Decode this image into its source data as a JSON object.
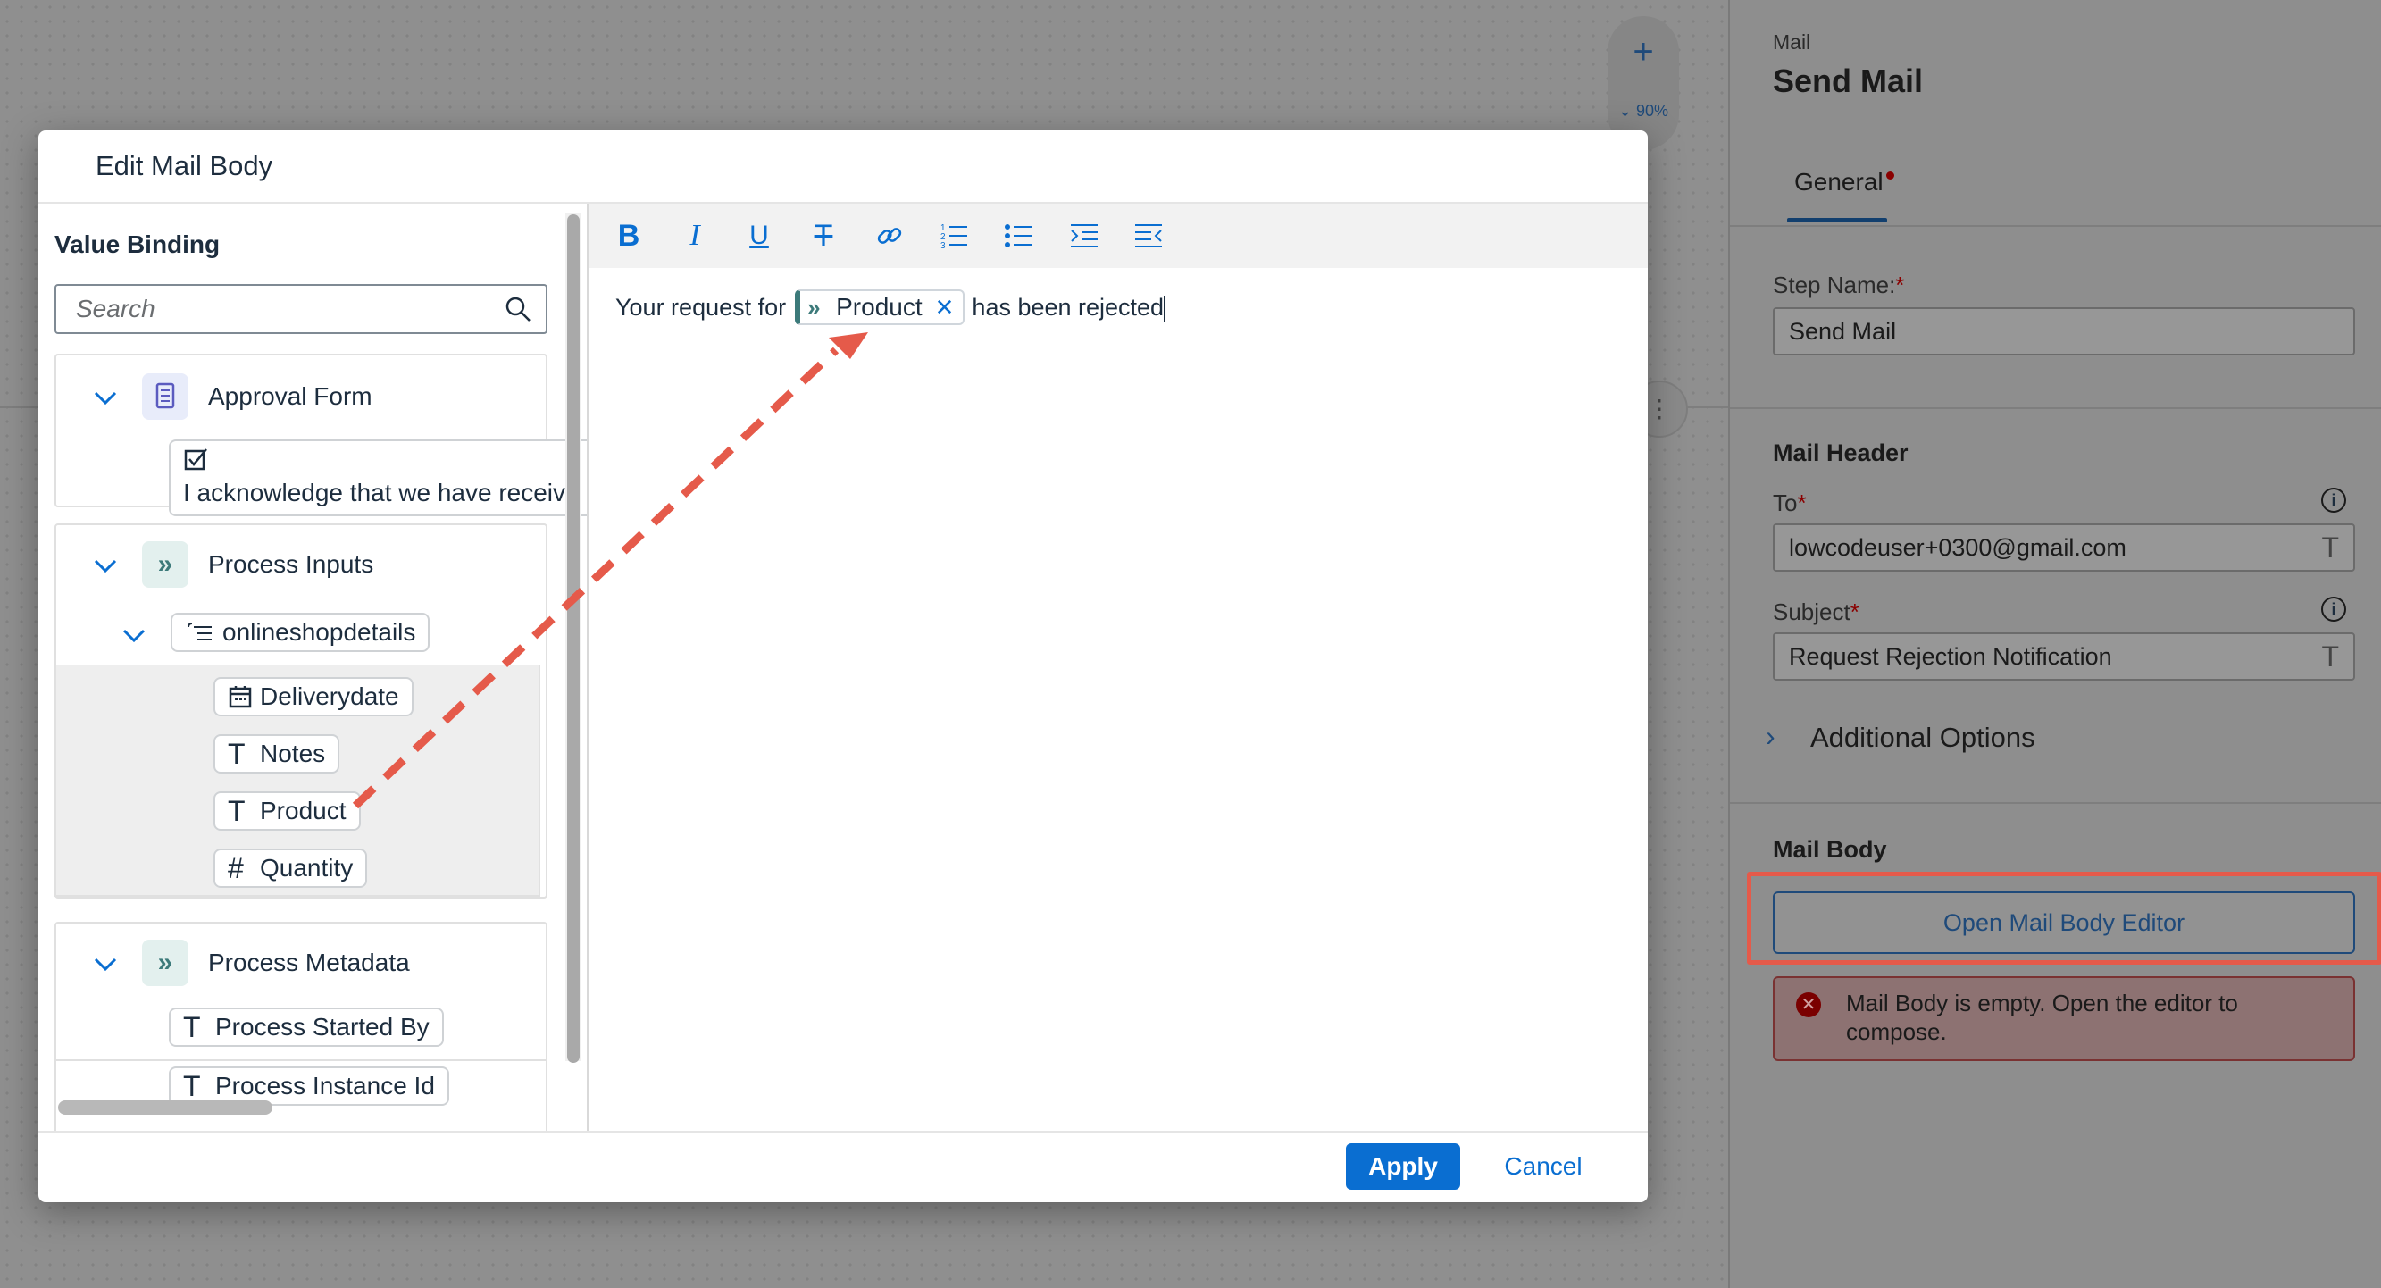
{
  "canvas": {
    "zoom_plus": "+",
    "zoom_value": "⌄ 90%",
    "more": "⋮"
  },
  "right_panel": {
    "crumb": "Mail",
    "title": "Send Mail",
    "tab_general": "General",
    "step_name_label": "Step Name:",
    "required_mark": "*",
    "step_name_value": "Send Mail",
    "mail_header_title": "Mail Header",
    "to_label": "To",
    "to_value": "lowcodeuser+0300@gmail.com",
    "subject_label": "Subject",
    "subject_value": "Request Rejection Notification",
    "info_glyph": "i",
    "type_glyph": "T",
    "additional_options": "Additional Options",
    "mail_body_title": "Mail Body",
    "open_editor_button": "Open Mail Body Editor",
    "error_message": "Mail Body is empty. Open the editor to compose.",
    "error_glyph": "✕"
  },
  "dialog": {
    "title": "Edit Mail Body",
    "value_binding_title": "Value Binding",
    "search_placeholder": "Search",
    "groups": {
      "approval_form": {
        "label": "Approval Form",
        "item": "I acknowledge that we have receiv"
      },
      "process_inputs": {
        "label": "Process Inputs",
        "subgroup": "onlineshopdetails",
        "items": [
          "Deliverydate",
          "Notes",
          "Product",
          "Quantity"
        ]
      },
      "process_metadata": {
        "label": "Process Metadata",
        "items": [
          "Process Started By",
          "Process Instance Id"
        ]
      }
    },
    "glyphs": {
      "text": "T",
      "number": "#",
      "chevrons": "»",
      "close": "✕"
    },
    "toolbar": {
      "bold": "B",
      "italic": "I",
      "underline": "U",
      "strikethrough": "T"
    },
    "editor": {
      "text_before": "Your request for",
      "token_label": "Product",
      "text_after": "has been rejected"
    },
    "apply_button": "Apply",
    "cancel_button": "Cancel"
  },
  "colors": {
    "accent": "#0a6ed1",
    "highlight": "#e55a4a",
    "error": "#8a0000"
  }
}
